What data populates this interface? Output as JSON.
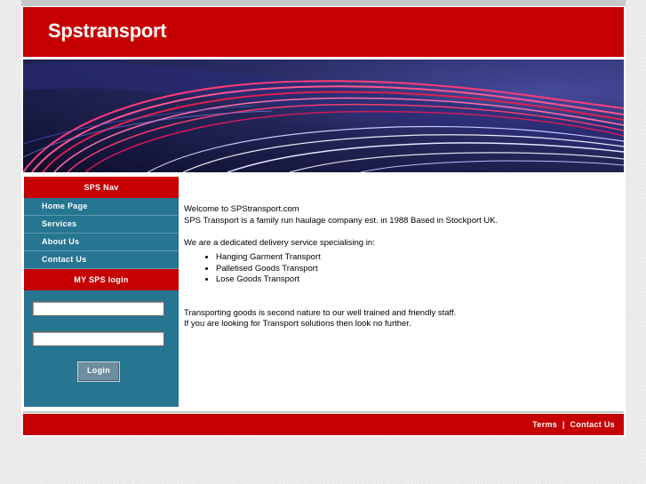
{
  "header": {
    "site_title": "Spstransport"
  },
  "sidebar": {
    "nav_title": "SPS Nav",
    "items": [
      {
        "label": "Home Page"
      },
      {
        "label": "Services"
      },
      {
        "label": "About Us"
      },
      {
        "label": "Contact Us"
      }
    ],
    "login_title": "MY SPS login",
    "login": {
      "username_value": "",
      "password_value": "",
      "button_label": "Login"
    }
  },
  "main": {
    "welcome": "Welcome to SPStransport.com",
    "intro": "SPS Transport is a family run haulage company est. in 1988 Based in Stockport UK.",
    "service_intro": "We are a dedicated delivery service specialising in:",
    "services": [
      "Hanging Garment Transport",
      "Palletised Goods Transport",
      "Lose Goods Transport"
    ],
    "closing_1": "Transporting goods is second nature to our well trained and friendly staff.",
    "closing_2": "If you are looking for Transport solutions then look no further."
  },
  "footer": {
    "terms": "Terms",
    "separator": "|",
    "contact": "Contact Us"
  }
}
